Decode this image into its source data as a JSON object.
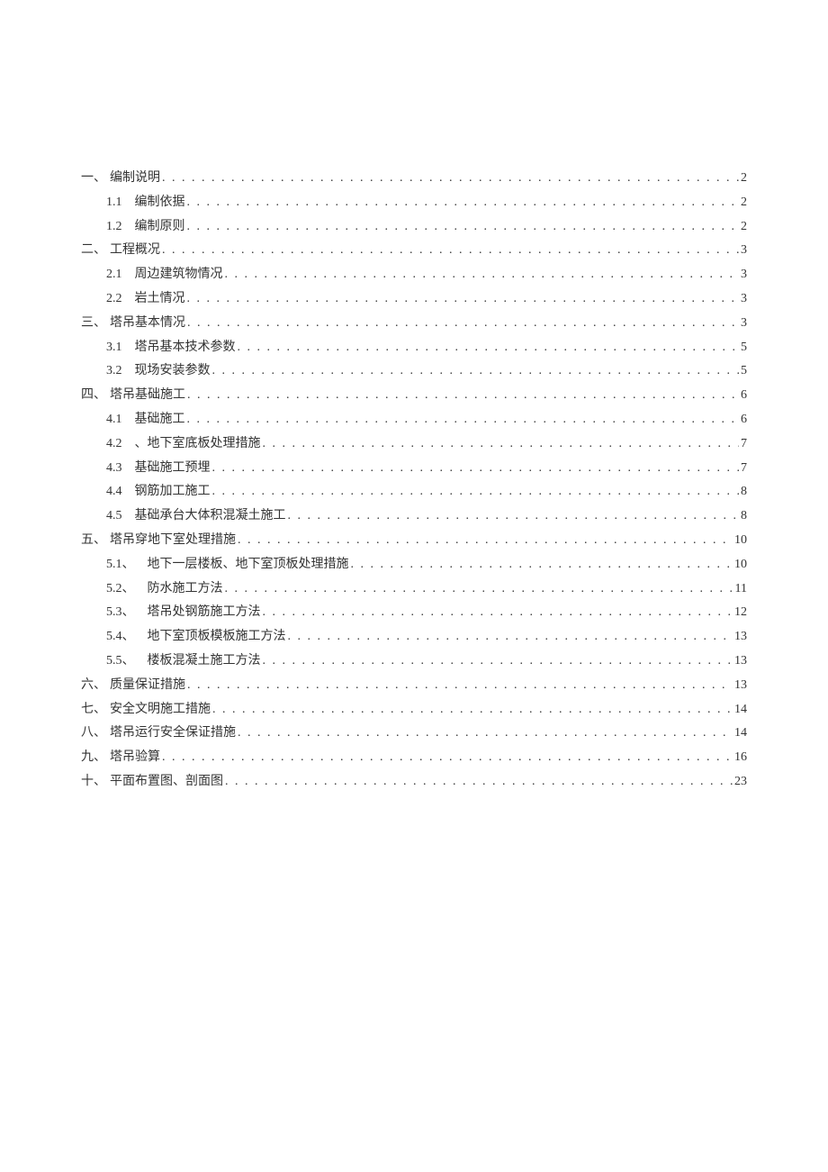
{
  "toc": [
    {
      "level": 1,
      "num": "一、",
      "title": "编制说明",
      "page": "2"
    },
    {
      "level": 2,
      "num": "1.1",
      "title": "编制依据",
      "page": "2"
    },
    {
      "level": 2,
      "num": "1.2",
      "title": "编制原则",
      "page": "2"
    },
    {
      "level": 1,
      "num": "二、",
      "title": "工程概况",
      "page": "3"
    },
    {
      "level": 2,
      "num": "2.1",
      "title": "周边建筑物情况",
      "page": "3"
    },
    {
      "level": 2,
      "num": "2.2",
      "title": "岩土情况",
      "page": "3"
    },
    {
      "level": 1,
      "num": "三、",
      "title": "塔吊基本情况",
      "page": "3"
    },
    {
      "level": 2,
      "num": "3.1",
      "title": "塔吊基本技术参数",
      "page": "5"
    },
    {
      "level": 2,
      "num": "3.2",
      "title": "现场安装参数",
      "page": "5"
    },
    {
      "level": 1,
      "num": "四、",
      "title": "塔吊基础施工",
      "page": "6"
    },
    {
      "level": 2,
      "num": "4.1",
      "title": "基础施工",
      "page": "6"
    },
    {
      "level": 2,
      "num": "4.2",
      "title": "、地下室底板处理措施",
      "page": "7"
    },
    {
      "level": 2,
      "num": "4.3",
      "title": "基础施工预埋",
      "page": "7"
    },
    {
      "level": 2,
      "num": "4.4",
      "title": "钢筋加工施工",
      "page": "8"
    },
    {
      "level": 2,
      "num": "4.5",
      "title": "基础承台大体积混凝土施工",
      "page": "8"
    },
    {
      "level": 1,
      "num": "五、",
      "title": "塔吊穿地下室处理措施",
      "page": "10"
    },
    {
      "level": 2,
      "num": "5.1、",
      "title": "地下一层楼板、地下室顶板处理措施",
      "page": "10"
    },
    {
      "level": 2,
      "num": "5.2、",
      "title": "防水施工方法",
      "page": "11"
    },
    {
      "level": 2,
      "num": "5.3、",
      "title": "塔吊处钢筋施工方法",
      "page": "12"
    },
    {
      "level": 2,
      "num": "5.4、",
      "title": "地下室顶板模板施工方法",
      "page": "13"
    },
    {
      "level": 2,
      "num": "5.5、",
      "title": "楼板混凝土施工方法",
      "page": "13"
    },
    {
      "level": 1,
      "num": "六、",
      "title": "质量保证措施",
      "page": "13"
    },
    {
      "level": 1,
      "num": "七、",
      "title": "安全文明施工措施",
      "page": "14"
    },
    {
      "level": 1,
      "num": "八、",
      "title": "塔吊运行安全保证措施",
      "page": "14"
    },
    {
      "level": 1,
      "num": "九、",
      "title": "塔吊验算",
      "page": "16"
    },
    {
      "level": 1,
      "num": "十、",
      "title": "平面布置图、剖面图",
      "page": "23"
    }
  ]
}
